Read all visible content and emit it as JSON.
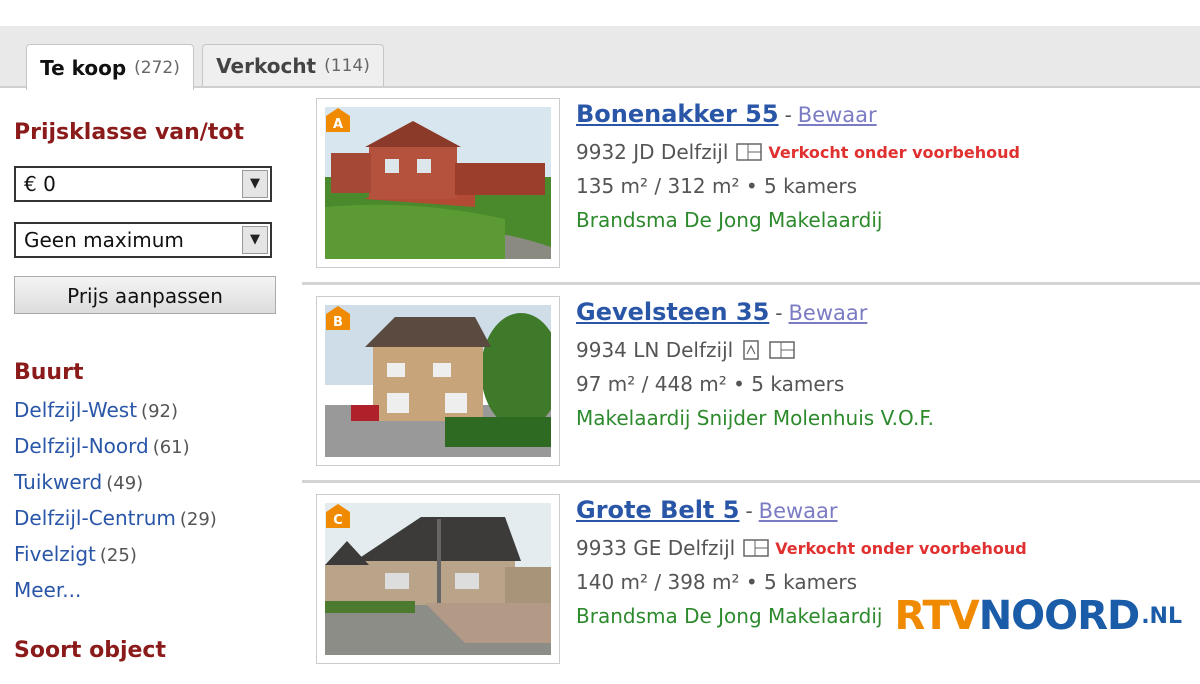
{
  "tabs": [
    {
      "label": "Te koop",
      "count": "(272)",
      "active": true
    },
    {
      "label": "Verkocht",
      "count": "(114)",
      "active": false
    }
  ],
  "sidebar": {
    "price_heading": "Prijsklasse van/tot",
    "min_select": "€ 0",
    "max_select": "Geen maximum",
    "apply_button": "Prijs aanpassen",
    "neighborhood_heading": "Buurt",
    "neighborhoods": [
      {
        "name": "Delfzijl-West",
        "count": "(92)"
      },
      {
        "name": "Delfzijl-Noord",
        "count": "(61)"
      },
      {
        "name": "Tuikwerd",
        "count": "(49)"
      },
      {
        "name": "Delfzijl-Centrum",
        "count": "(29)"
      },
      {
        "name": "Fivelzigt",
        "count": "(25)"
      }
    ],
    "more_link": "Meer...",
    "object_heading": "Soort object"
  },
  "listings": [
    {
      "badge": "A",
      "address": "Bonenakker 55",
      "separator": "-",
      "save": "Bewaar",
      "postal": "9932 JD Delfzijl",
      "status": "Verkocht onder voorbehoud",
      "details": "135 m² / 312 m² • 5 kamers",
      "agency": "Brandsma De Jong Makelaardij"
    },
    {
      "badge": "B",
      "address": "Gevelsteen 35",
      "separator": "-",
      "save": "Bewaar",
      "postal": "9934 LN Delfzijl",
      "status": "",
      "details": "97 m² / 448 m² • 5 kamers",
      "agency": "Makelaardij Snijder Molenhuis V.O.F."
    },
    {
      "badge": "C",
      "address": "Grote Belt 5",
      "separator": "-",
      "save": "Bewaar",
      "postal": "9933 GE Delfzijl",
      "status": "Verkocht onder voorbehoud",
      "details": "140 m² / 398 m² • 5 kamers",
      "agency": "Brandsma De Jong Makelaardij"
    }
  ],
  "logo": {
    "part1": "RTV",
    "part2": "NOORD",
    "part3": ".NL"
  },
  "colors": {
    "link": "#2a56a8",
    "heading": "#8b1a1a",
    "agency": "#2d8a2d",
    "status": "#e03030",
    "badge": "#f08a00"
  }
}
